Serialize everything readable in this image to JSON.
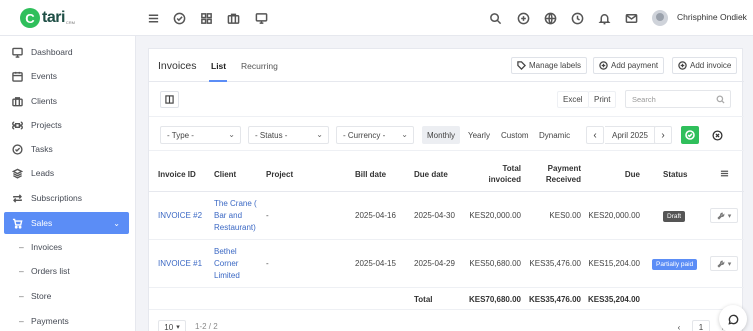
{
  "brand": {
    "logo_letter": "C",
    "logo_text": "tari",
    "logo_sub": "CRM",
    "accent": "#5b8df6",
    "green": "#2fbf5b"
  },
  "topbar": {
    "icons": [
      "menu-icon",
      "check-circle-icon",
      "grid-icon",
      "briefcase-icon",
      "monitor-icon",
      "search-icon",
      "plus-circle-icon",
      "globe-icon",
      "clock-icon",
      "bell-icon",
      "mail-icon"
    ],
    "username": "Chrisphine Ondiek"
  },
  "sidebar": {
    "items": [
      {
        "label": "Dashboard",
        "icon": "monitor-icon"
      },
      {
        "label": "Events",
        "icon": "calendar-icon"
      },
      {
        "label": "Clients",
        "icon": "briefcase-icon"
      },
      {
        "label": "Projects",
        "icon": "command-icon"
      },
      {
        "label": "Tasks",
        "icon": "check-circle-icon"
      },
      {
        "label": "Leads",
        "icon": "layers-icon"
      },
      {
        "label": "Subscriptions",
        "icon": "repeat-icon"
      },
      {
        "label": "Sales",
        "icon": "cart-icon",
        "active": true
      }
    ],
    "subitems": [
      {
        "label": "Invoices"
      },
      {
        "label": "Orders list"
      },
      {
        "label": "Store"
      },
      {
        "label": "Payments"
      }
    ]
  },
  "page": {
    "title": "Invoices",
    "tabs": [
      {
        "label": "List",
        "active": true
      },
      {
        "label": "Recurring"
      }
    ],
    "buttons": {
      "manage_labels": "Manage labels",
      "add_payment": "Add payment",
      "add_invoice": "Add invoice"
    },
    "tools": {
      "excel": "Excel",
      "print": "Print",
      "search_placeholder": "Search"
    },
    "filters": {
      "type": "- Type -",
      "status": "- Status -",
      "currency": "- Currency -",
      "periods": [
        "Monthly",
        "Yearly",
        "Custom",
        "Dynamic"
      ],
      "active_period": "Monthly",
      "month": "April 2025"
    }
  },
  "table": {
    "headers": {
      "invoice_id": "Invoice ID",
      "client": "Client",
      "project": "Project",
      "bill_date": "Bill date",
      "due_date": "Due date",
      "total_invoiced_1": "Total",
      "total_invoiced_2": "invoiced",
      "payment_received_1": "Payment",
      "payment_received_2": "Received",
      "due": "Due",
      "status": "Status"
    },
    "rows": [
      {
        "invoice_id": "INVOICE #2",
        "client_lines": [
          "The Crane (",
          "Bar and",
          "Restaurant)"
        ],
        "project": "-",
        "bill_date": "2025-04-16",
        "due_date": "2025-04-30",
        "total_invoiced": "KES20,000.00",
        "payment_received": "KES0.00",
        "due": "KES20,000.00",
        "status": "Draft",
        "status_color": "#555555"
      },
      {
        "invoice_id": "INVOICE #1",
        "client_lines": [
          "Bethel",
          "Corner",
          "Limited"
        ],
        "project": "-",
        "bill_date": "2025-04-15",
        "due_date": "2025-04-29",
        "total_invoiced": "KES50,680.00",
        "payment_received": "KES35,476.00",
        "due": "KES15,204.00",
        "status": "Partially paid",
        "status_color": "#5b8df6"
      }
    ],
    "totals": {
      "label": "Total",
      "total_invoiced": "KES70,680.00",
      "payment_received": "KES35,476.00",
      "due": "KES35,204.00"
    }
  },
  "pagination": {
    "page_size": "10",
    "range": "1-2 / 2",
    "current_page": "1"
  }
}
